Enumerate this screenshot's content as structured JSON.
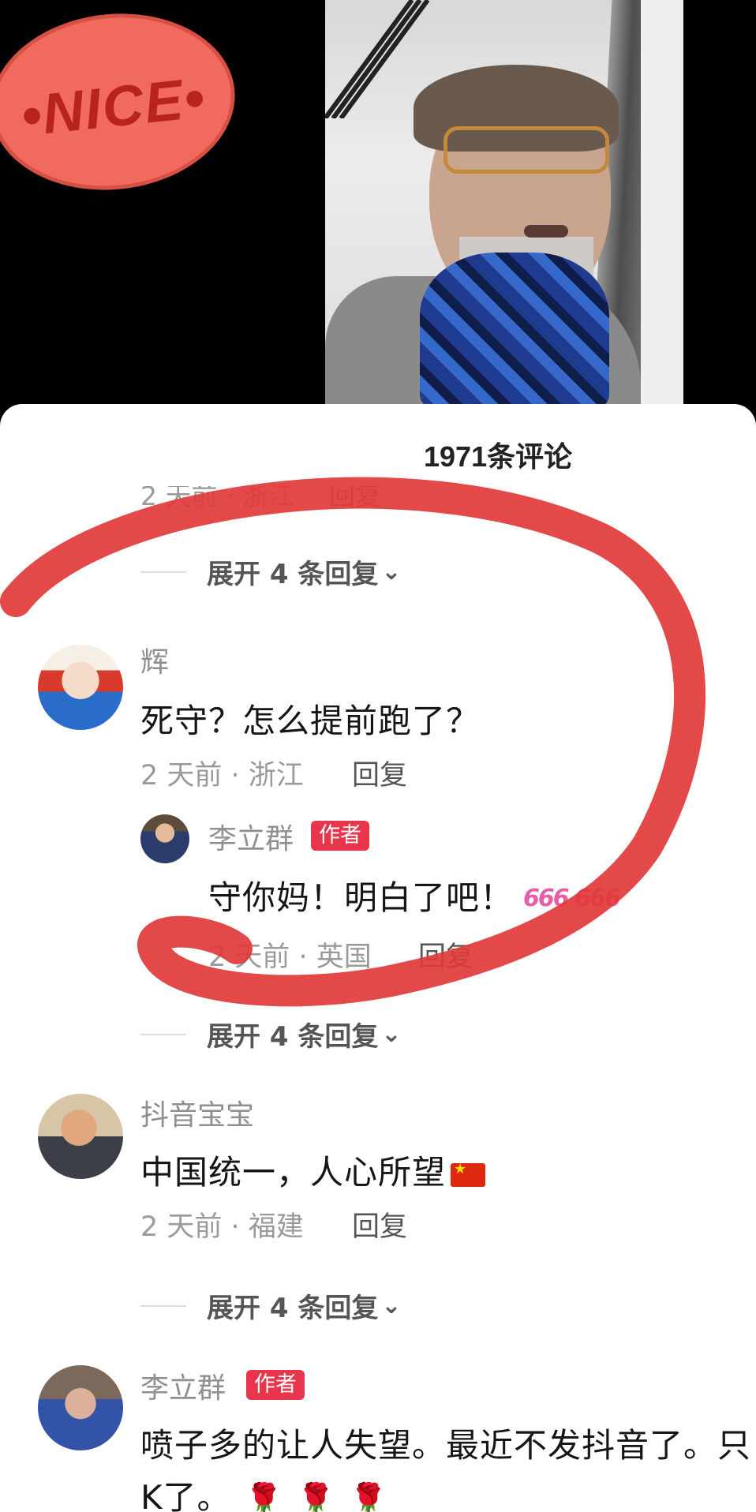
{
  "video": {
    "badge_text": "•NICE•"
  },
  "sheet": {
    "title": "1971条评论",
    "ghost_meta": {
      "time_loc": "2 天前 · 浙江",
      "reply": "回复"
    },
    "expand_top": "展开 4 条回复",
    "comments": [
      {
        "name": "辉",
        "text": "死守？怎么提前跑了？",
        "meta": "2 天前 · 浙江",
        "reply": "回复",
        "sub_reply": {
          "name": "李立群",
          "tag": "作者",
          "text": "守你妈！明白了吧！",
          "emoji": "666 666",
          "meta": "2 天前 · 英国",
          "reply": "回复"
        },
        "expand": "展开 4 条回复"
      },
      {
        "name": "抖音宝宝",
        "text": "中国统一，人心所望",
        "meta": "2 天前 · 福建",
        "reply": "回复",
        "expand": "展开 4 条回复"
      },
      {
        "name": "李立群",
        "tag": "作者",
        "text_line1": "喷子多的让人失望。最近不发抖音了。只",
        "text_line2": "K了。"
      }
    ]
  },
  "colors": {
    "author_tag": "#e8354c",
    "annotation_circle": "#e23a3a"
  }
}
